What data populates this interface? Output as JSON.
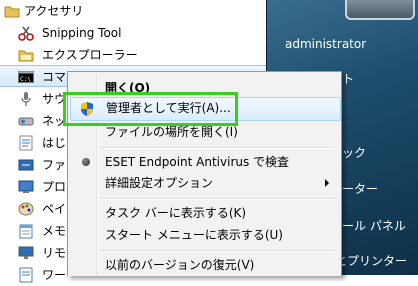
{
  "program_list": {
    "folder_label": "アクセサリ",
    "items": [
      {
        "label": "Snipping Tool",
        "icon": "scissors-icon"
      },
      {
        "label": "エクスプローラー",
        "icon": "folder-icon"
      },
      {
        "label": "コマンド プロンプト",
        "icon": "command-prompt-icon"
      },
      {
        "label": "サウ",
        "icon": "microphone-icon"
      },
      {
        "label": "ネッ",
        "icon": "network-projector-icon"
      },
      {
        "label": "はじ",
        "icon": "getting-started-icon"
      },
      {
        "label": "ファ",
        "icon": "file-transfer-icon"
      },
      {
        "label": "プロ",
        "icon": "projector-icon"
      },
      {
        "label": "ペイ",
        "icon": "paint-icon"
      },
      {
        "label": "メモ",
        "icon": "notepad-icon"
      },
      {
        "label": "リモ",
        "icon": "remote-desktop-icon"
      },
      {
        "label": "ワー",
        "icon": "wordpad-icon"
      }
    ]
  },
  "right_pane": {
    "user_name": "administrator",
    "items": [
      "ト",
      "ック",
      "ーター",
      "ール パネル",
      "とプリンター"
    ]
  },
  "context_menu": {
    "items": [
      {
        "label": "開く(O)",
        "bold": true
      },
      {
        "label": "管理者として実行(A)...",
        "icon": "uac-shield-icon",
        "highlighted": true
      },
      {
        "label": "ファイルの場所を開く(I)"
      },
      {
        "label": "ESET Endpoint Antivirus で検査",
        "icon": "eset-icon"
      },
      {
        "label": "詳細設定オプション",
        "submenu": true
      },
      {
        "label": "タスク バーに表示する(K)"
      },
      {
        "label": "スタート メニューに表示する(U)"
      },
      {
        "label": "以前のバージョンの復元(V)"
      }
    ]
  },
  "colors": {
    "highlight_callout": "#35d11e",
    "menu_background": "#f2f2f2",
    "right_pane": "#1e4e6e"
  }
}
